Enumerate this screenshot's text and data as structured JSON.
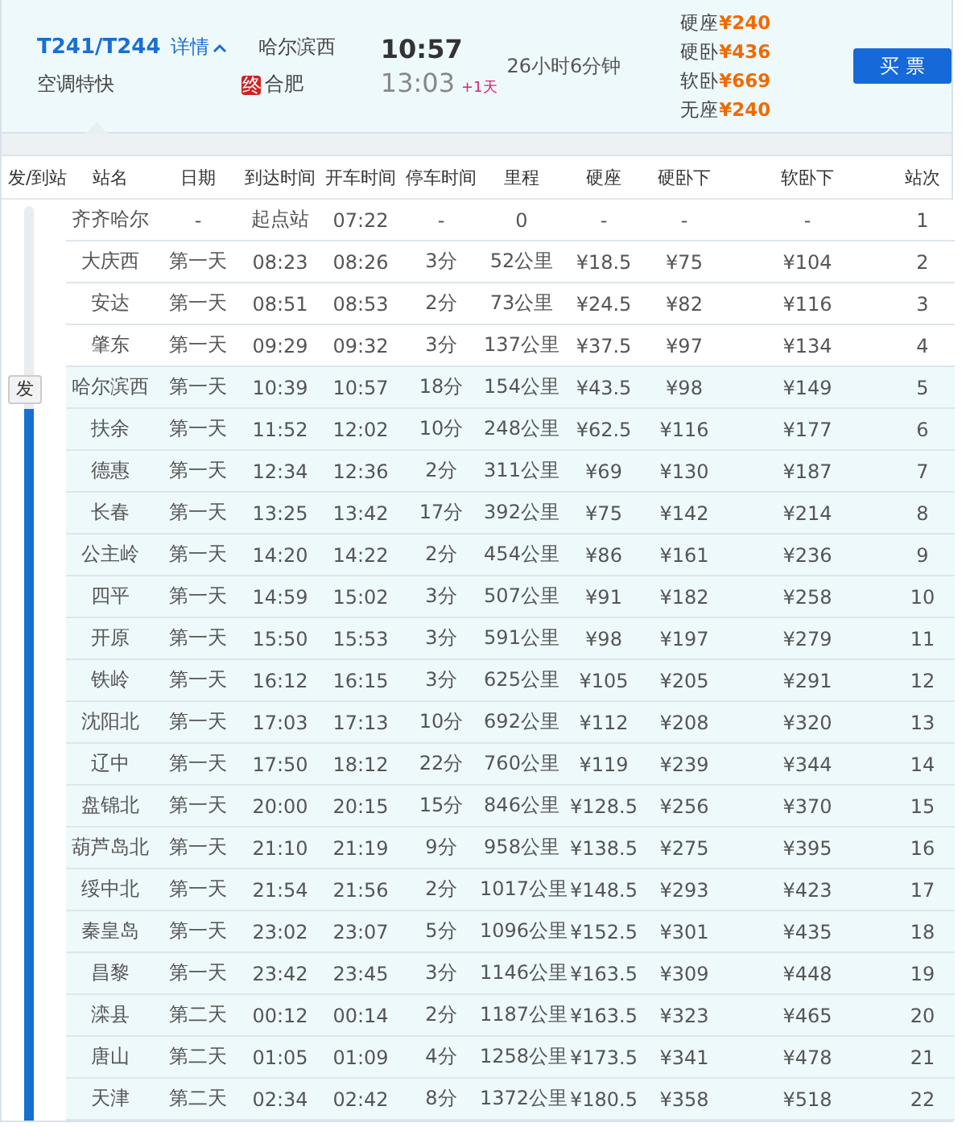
{
  "train": {
    "number": "T241/T244",
    "details_link": "详情",
    "expanded": true,
    "type": "空调特快",
    "from_station": "哈尔滨西",
    "to_badge": "终",
    "to_station": "合肥",
    "depart_time": "10:57",
    "arrive_time": "13:03",
    "day_offset": "+1天",
    "duration": "26小时6分钟",
    "prices": [
      {
        "seat": "硬座",
        "price": "¥240"
      },
      {
        "seat": "硬卧",
        "price": "¥436"
      },
      {
        "seat": "软卧",
        "price": "¥669"
      },
      {
        "seat": "无座",
        "price": "¥240"
      }
    ],
    "buy_button": "买 票"
  },
  "table": {
    "columns": [
      "发/到站",
      "站名",
      "日期",
      "到达时间",
      "开车时间",
      "停车时间",
      "里程",
      "硬座",
      "硬卧下",
      "软卧下",
      "站次"
    ],
    "depart_marker": "发",
    "rows": [
      {
        "on_route": false,
        "cells": [
          "",
          "齐齐哈尔",
          "-",
          "起点站",
          "07:22",
          "-",
          "0",
          "-",
          "-",
          "-",
          "1"
        ]
      },
      {
        "on_route": false,
        "cells": [
          "",
          "大庆西",
          "第一天",
          "08:23",
          "08:26",
          "3分",
          "52公里",
          "¥18.5",
          "¥75",
          "¥104",
          "2"
        ]
      },
      {
        "on_route": false,
        "cells": [
          "",
          "安达",
          "第一天",
          "08:51",
          "08:53",
          "2分",
          "73公里",
          "¥24.5",
          "¥82",
          "¥116",
          "3"
        ]
      },
      {
        "on_route": false,
        "cells": [
          "",
          "肇东",
          "第一天",
          "09:29",
          "09:32",
          "3分",
          "137公里",
          "¥37.5",
          "¥97",
          "¥134",
          "4"
        ]
      },
      {
        "on_route": true,
        "cells": [
          "",
          "哈尔滨西",
          "第一天",
          "10:39",
          "10:57",
          "18分",
          "154公里",
          "¥43.5",
          "¥98",
          "¥149",
          "5"
        ]
      },
      {
        "on_route": true,
        "cells": [
          "",
          "扶余",
          "第一天",
          "11:52",
          "12:02",
          "10分",
          "248公里",
          "¥62.5",
          "¥116",
          "¥177",
          "6"
        ]
      },
      {
        "on_route": true,
        "cells": [
          "",
          "德惠",
          "第一天",
          "12:34",
          "12:36",
          "2分",
          "311公里",
          "¥69",
          "¥130",
          "¥187",
          "7"
        ]
      },
      {
        "on_route": true,
        "cells": [
          "",
          "长春",
          "第一天",
          "13:25",
          "13:42",
          "17分",
          "392公里",
          "¥75",
          "¥142",
          "¥214",
          "8"
        ]
      },
      {
        "on_route": true,
        "cells": [
          "",
          "公主岭",
          "第一天",
          "14:20",
          "14:22",
          "2分",
          "454公里",
          "¥86",
          "¥161",
          "¥236",
          "9"
        ]
      },
      {
        "on_route": true,
        "cells": [
          "",
          "四平",
          "第一天",
          "14:59",
          "15:02",
          "3分",
          "507公里",
          "¥91",
          "¥182",
          "¥258",
          "10"
        ]
      },
      {
        "on_route": true,
        "cells": [
          "",
          "开原",
          "第一天",
          "15:50",
          "15:53",
          "3分",
          "591公里",
          "¥98",
          "¥197",
          "¥279",
          "11"
        ]
      },
      {
        "on_route": true,
        "cells": [
          "",
          "铁岭",
          "第一天",
          "16:12",
          "16:15",
          "3分",
          "625公里",
          "¥105",
          "¥205",
          "¥291",
          "12"
        ]
      },
      {
        "on_route": true,
        "cells": [
          "",
          "沈阳北",
          "第一天",
          "17:03",
          "17:13",
          "10分",
          "692公里",
          "¥112",
          "¥208",
          "¥320",
          "13"
        ]
      },
      {
        "on_route": true,
        "cells": [
          "",
          "辽中",
          "第一天",
          "17:50",
          "18:12",
          "22分",
          "760公里",
          "¥119",
          "¥239",
          "¥344",
          "14"
        ]
      },
      {
        "on_route": true,
        "cells": [
          "",
          "盘锦北",
          "第一天",
          "20:00",
          "20:15",
          "15分",
          "846公里",
          "¥128.5",
          "¥256",
          "¥370",
          "15"
        ]
      },
      {
        "on_route": true,
        "cells": [
          "",
          "葫芦岛北",
          "第一天",
          "21:10",
          "21:19",
          "9分",
          "958公里",
          "¥138.5",
          "¥275",
          "¥395",
          "16"
        ]
      },
      {
        "on_route": true,
        "cells": [
          "",
          "绥中北",
          "第一天",
          "21:54",
          "21:56",
          "2分",
          "1017公里",
          "¥148.5",
          "¥293",
          "¥423",
          "17"
        ]
      },
      {
        "on_route": true,
        "cells": [
          "",
          "秦皇岛",
          "第一天",
          "23:02",
          "23:07",
          "5分",
          "1096公里",
          "¥152.5",
          "¥301",
          "¥435",
          "18"
        ]
      },
      {
        "on_route": true,
        "cells": [
          "",
          "昌黎",
          "第一天",
          "23:42",
          "23:45",
          "3分",
          "1146公里",
          "¥163.5",
          "¥309",
          "¥448",
          "19"
        ]
      },
      {
        "on_route": true,
        "cells": [
          "",
          "滦县",
          "第二天",
          "00:12",
          "00:14",
          "2分",
          "1187公里",
          "¥163.5",
          "¥323",
          "¥465",
          "20"
        ]
      },
      {
        "on_route": true,
        "cells": [
          "",
          "唐山",
          "第二天",
          "01:05",
          "01:09",
          "4分",
          "1258公里",
          "¥173.5",
          "¥341",
          "¥478",
          "21"
        ]
      },
      {
        "on_route": true,
        "cells": [
          "",
          "天津",
          "第二天",
          "02:34",
          "02:42",
          "8分",
          "1372公里",
          "¥180.5",
          "¥358",
          "¥518",
          "22"
        ]
      }
    ]
  }
}
